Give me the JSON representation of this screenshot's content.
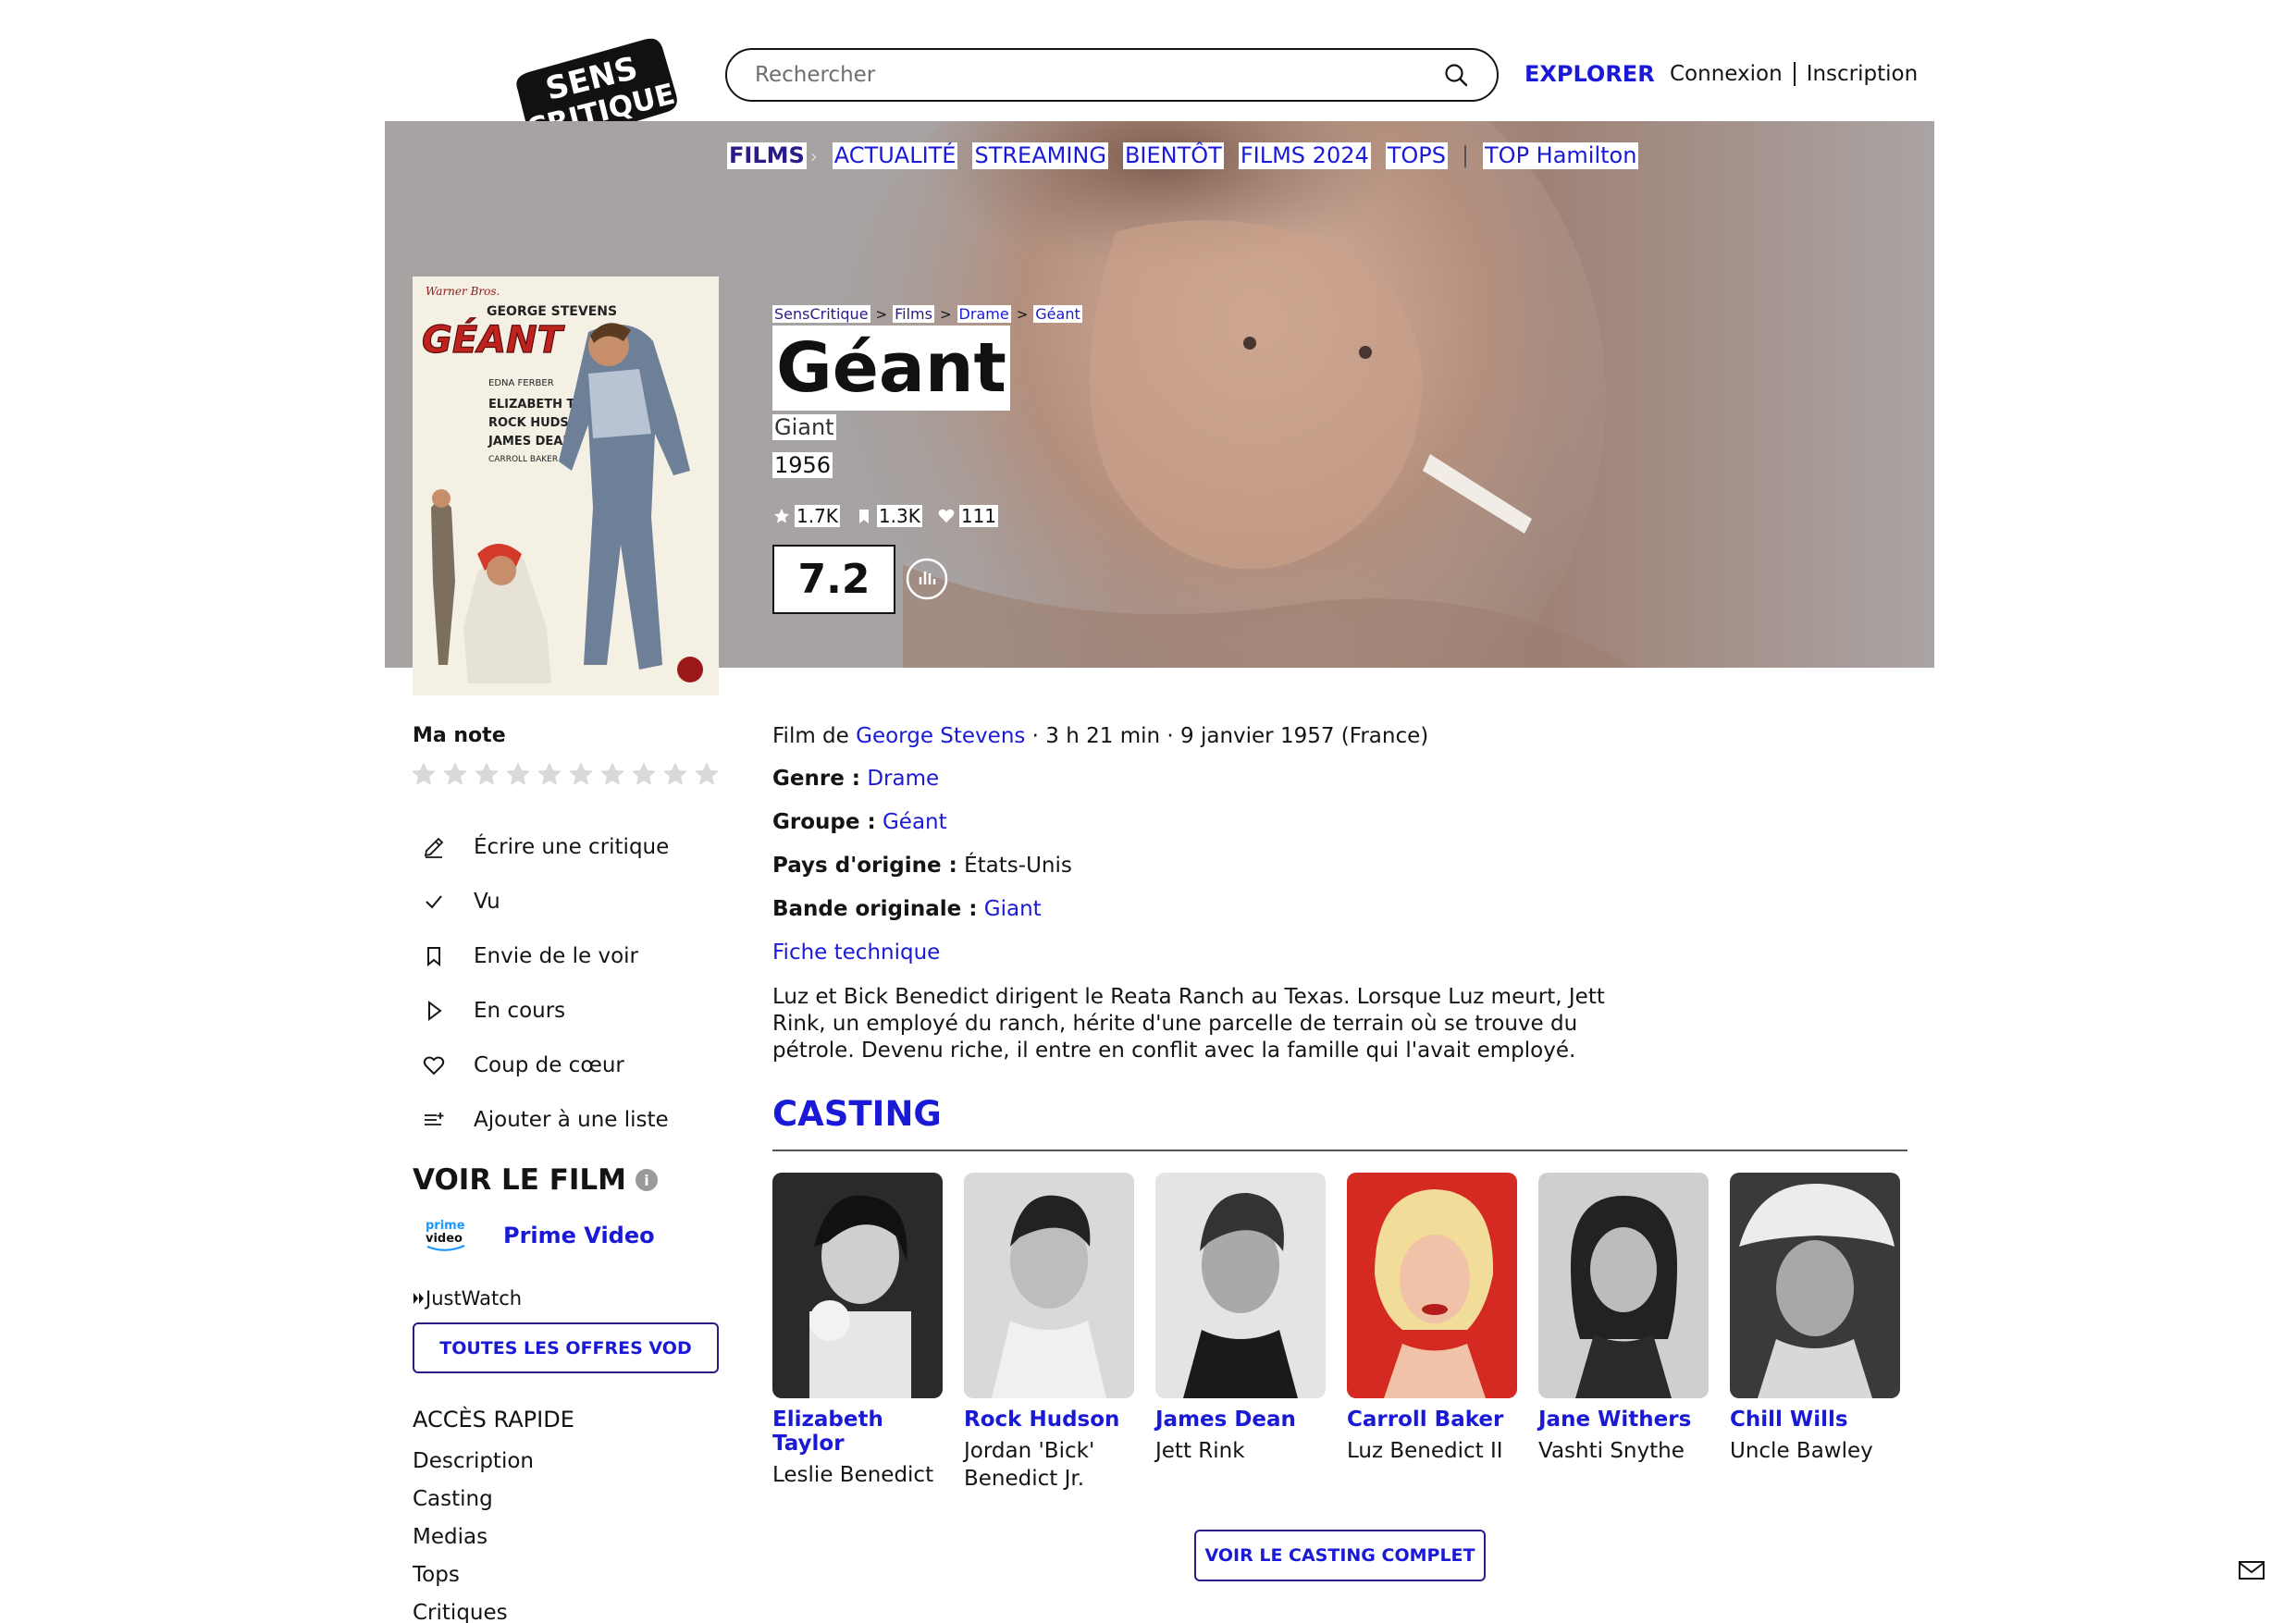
{
  "header": {
    "logo_lines": [
      "SENS",
      "CRITIQUE"
    ],
    "search_placeholder": "Rechercher",
    "explorer": "EXPLORER",
    "login": "Connexion",
    "signup": "Inscription"
  },
  "nav": {
    "items": [
      "FILMS",
      "ACTUALITÉ",
      "STREAMING",
      "BIENTÔT",
      "FILMS 2024",
      "TOPS",
      "TOP Hamilton"
    ]
  },
  "poster": {
    "studio": "Warner Bros.",
    "director": "GEORGE STEVENS",
    "title": "GÉANT",
    "credits": [
      "EDNA FERBER",
      "ELIZABETH TAYLOR",
      "ROCK HUDSON",
      "JAMES DEAN",
      "CARROLL BAKER"
    ]
  },
  "breadcrumb": [
    "SensCritique",
    "Films",
    "Drame",
    "Géant"
  ],
  "film": {
    "title": "Géant",
    "original_title": "Giant",
    "year": "1956",
    "ratings_count": "1.7K",
    "wishlist_count": "1.3K",
    "favorites_count": "111",
    "score": "7.2",
    "film_de_prefix": "Film de",
    "director": "George Stevens",
    "details_suffix": " · 3 h 21 min · 9 janvier 1957 (France)",
    "genre_label": "Genre :",
    "genre": "Drame",
    "group_label": "Groupe :",
    "group": "Géant",
    "country_label": "Pays d'origine :",
    "country": "États-Unis",
    "soundtrack_label": "Bande originale :",
    "soundtrack": "Giant",
    "tech_sheet": "Fiche technique",
    "synopsis": "Luz et Bick Benedict dirigent le Reata Ranch au Texas. Lorsque Luz meurt, Jett Rink, un employé du ranch, hérite d'une parcelle de terrain où se trouve du pétrole. Devenu riche, il entre en conflit avec la famille qui l'avait employé."
  },
  "sidebar": {
    "my_rating": "Ma note",
    "actions": [
      {
        "label": "Écrire une critique",
        "icon": "pencil-icon"
      },
      {
        "label": "Vu",
        "icon": "check-icon"
      },
      {
        "label": "Envie de le voir",
        "icon": "bookmark-icon"
      },
      {
        "label": "En cours",
        "icon": "play-icon"
      },
      {
        "label": "Coup de cœur",
        "icon": "heart-icon"
      },
      {
        "label": "Ajouter à une liste",
        "icon": "list-add-icon"
      }
    ],
    "watch_title": "VOIR LE FILM",
    "provider": "Prime Video",
    "provider_logo": [
      "prime",
      "video"
    ],
    "justwatch": "JustWatch",
    "vod_button": "TOUTES LES OFFRES VOD",
    "quick_access_title": "ACCÈS RAPIDE",
    "quick_links": [
      "Description",
      "Casting",
      "Medias",
      "Tops",
      "Critiques"
    ]
  },
  "casting": {
    "title": "CASTING",
    "members": [
      {
        "name": "Elizabeth Taylor",
        "role": "Leslie Benedict"
      },
      {
        "name": "Rock Hudson",
        "role": "Jordan 'Bick' Benedict Jr."
      },
      {
        "name": "James Dean",
        "role": "Jett Rink"
      },
      {
        "name": "Carroll Baker",
        "role": "Luz Benedict II"
      },
      {
        "name": "Jane Withers",
        "role": "Vashti Snythe"
      },
      {
        "name": "Chill Wills",
        "role": "Uncle Bawley"
      }
    ],
    "full_button": "VOIR LE CASTING COMPLET"
  },
  "colors": {
    "link": "#1a1ad6",
    "brand_dark": "#2a1c88",
    "banner_tint": "#a7a3a3"
  }
}
